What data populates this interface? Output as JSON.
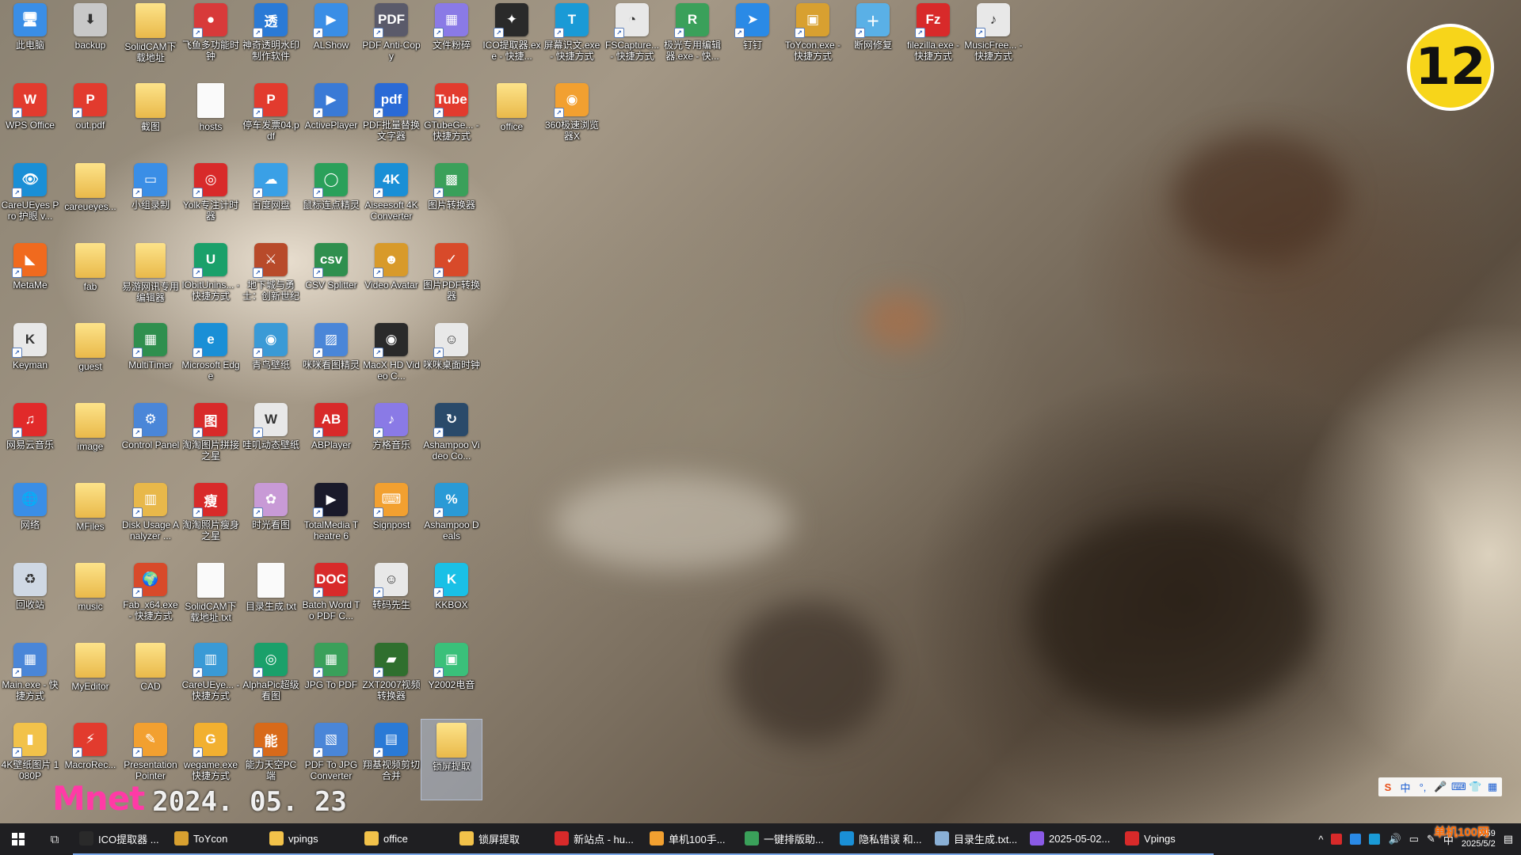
{
  "desktop": {
    "icons": [
      {
        "label": "此电脑",
        "color": "#3a8ee6",
        "glyph": "🖥",
        "kind": "app",
        "shortcut": false
      },
      {
        "label": "WPS Office",
        "color": "#e23b2e",
        "glyph": "W",
        "kind": "app",
        "shortcut": true
      },
      {
        "label": "CareUEyes Pro 护眼 v...",
        "color": "#1a8fd6",
        "glyph": "👁",
        "kind": "app",
        "shortcut": true
      },
      {
        "label": "MetaMe",
        "color": "#f06a1e",
        "glyph": "◣",
        "kind": "app",
        "shortcut": true
      },
      {
        "label": "Keyman",
        "color": "#e8e8e8",
        "glyph": "K",
        "kind": "app",
        "shortcut": true
      },
      {
        "label": "网易云音乐",
        "color": "#e12a2a",
        "glyph": "♫",
        "kind": "app",
        "shortcut": true
      },
      {
        "label": "网络",
        "color": "#3a8ee6",
        "glyph": "🌐",
        "kind": "app",
        "shortcut": false
      },
      {
        "label": "回收站",
        "color": "#cfd8e4",
        "glyph": "♻",
        "kind": "app",
        "shortcut": false
      },
      {
        "label": "Main.exe - 快捷方式",
        "color": "#4a86d8",
        "glyph": "▦",
        "kind": "app",
        "shortcut": true
      },
      {
        "label": "4K壁纸图片 1080P",
        "color": "#f2c24a",
        "glyph": "▮",
        "kind": "app",
        "shortcut": true
      },
      {
        "label": "backup",
        "color": "#c8c8c8",
        "glyph": "⬇",
        "kind": "app",
        "shortcut": false
      },
      {
        "label": "out.pdf",
        "color": "#e23b2e",
        "glyph": "P",
        "kind": "app",
        "shortcut": true
      },
      {
        "label": "careueyes...",
        "color": "",
        "glyph": "",
        "kind": "folder",
        "shortcut": false
      },
      {
        "label": "fab",
        "color": "",
        "glyph": "",
        "kind": "folder",
        "shortcut": false
      },
      {
        "label": "guest",
        "color": "",
        "glyph": "",
        "kind": "folder",
        "shortcut": false
      },
      {
        "label": "image",
        "color": "",
        "glyph": "",
        "kind": "folder",
        "shortcut": false
      },
      {
        "label": "MFiles",
        "color": "",
        "glyph": "",
        "kind": "folder",
        "shortcut": false
      },
      {
        "label": "music",
        "color": "",
        "glyph": "",
        "kind": "folder",
        "shortcut": false
      },
      {
        "label": "MyEditor",
        "color": "",
        "glyph": "",
        "kind": "folder",
        "shortcut": false
      },
      {
        "label": "MacroRec...",
        "color": "#e23b2e",
        "glyph": "⚡",
        "kind": "app",
        "shortcut": true
      },
      {
        "label": "SolidCAM下载地址",
        "color": "",
        "glyph": "",
        "kind": "folder",
        "shortcut": false
      },
      {
        "label": "截图",
        "color": "",
        "glyph": "",
        "kind": "folder",
        "shortcut": false
      },
      {
        "label": "小组录制",
        "color": "#3a8ee6",
        "glyph": "▭",
        "kind": "app",
        "shortcut": true
      },
      {
        "label": "易游网讯专用编辑器",
        "color": "",
        "glyph": "",
        "kind": "folder",
        "shortcut": false
      },
      {
        "label": "MultiTimer",
        "color": "#2f8f4e",
        "glyph": "▦",
        "kind": "app",
        "shortcut": true
      },
      {
        "label": "Control Panel",
        "color": "#4a86d8",
        "glyph": "⚙",
        "kind": "app",
        "shortcut": true
      },
      {
        "label": "Disk Usage Analyzer ...",
        "color": "#e8b84a",
        "glyph": "▥",
        "kind": "app",
        "shortcut": true
      },
      {
        "label": "Fab_x64.exe - 快捷方式",
        "color": "#d84a2a",
        "glyph": "🌍",
        "kind": "app",
        "shortcut": true
      },
      {
        "label": "CAD",
        "color": "",
        "glyph": "",
        "kind": "folder",
        "shortcut": false
      },
      {
        "label": "Presentation Pointer",
        "color": "#f2a030",
        "glyph": "✎",
        "kind": "app",
        "shortcut": true
      },
      {
        "label": "飞鱼多功能时钟",
        "color": "#d83a3a",
        "glyph": "●",
        "kind": "app",
        "shortcut": true
      },
      {
        "label": "hosts",
        "color": "",
        "glyph": "",
        "kind": "doc",
        "shortcut": false
      },
      {
        "label": "Yolk专注计时器",
        "color": "#d82a2a",
        "glyph": "◎",
        "kind": "app",
        "shortcut": true
      },
      {
        "label": "IObitUnins... - 快捷方式",
        "color": "#1aa06a",
        "glyph": "U",
        "kind": "app",
        "shortcut": true
      },
      {
        "label": "Microsoft Edge",
        "color": "#1a8fd6",
        "glyph": "e",
        "kind": "app",
        "shortcut": true
      },
      {
        "label": "淘淘图片拼接之星",
        "color": "#d82a2a",
        "glyph": "图",
        "kind": "app",
        "shortcut": true
      },
      {
        "label": "淘淘照片瘦身之星",
        "color": "#d82a2a",
        "glyph": "瘦",
        "kind": "app",
        "shortcut": true
      },
      {
        "label": "SolidCAM下载地址.txt",
        "color": "",
        "glyph": "",
        "kind": "doc",
        "shortcut": false
      },
      {
        "label": "CareUEye... - 快捷方式",
        "color": "#3a9ad6",
        "glyph": "▥",
        "kind": "app",
        "shortcut": true
      },
      {
        "label": "wegame.exe 快捷方式",
        "color": "#f2b030",
        "glyph": "G",
        "kind": "app",
        "shortcut": true
      },
      {
        "label": "神奇透明水印制作软件",
        "color": "#2a7ad6",
        "glyph": "透",
        "kind": "app",
        "shortcut": true
      },
      {
        "label": "停车发票04.pdf",
        "color": "#e23b2e",
        "glyph": "P",
        "kind": "app",
        "shortcut": true
      },
      {
        "label": "百度网盘",
        "color": "#3aa0e6",
        "glyph": "☁",
        "kind": "app",
        "shortcut": true
      },
      {
        "label": "地下城与勇士：创新世纪",
        "color": "#b84a2a",
        "glyph": "⚔",
        "kind": "app",
        "shortcut": true
      },
      {
        "label": "青鸟壁纸",
        "color": "#3a9ad6",
        "glyph": "◉",
        "kind": "app",
        "shortcut": true
      },
      {
        "label": "哇叽动态壁纸",
        "color": "#e8e8e8",
        "glyph": "W",
        "kind": "app",
        "shortcut": true
      },
      {
        "label": "时光看图",
        "color": "#c89ad6",
        "glyph": "✿",
        "kind": "app",
        "shortcut": true
      },
      {
        "label": "目录生成.txt",
        "color": "",
        "glyph": "",
        "kind": "doc",
        "shortcut": false
      },
      {
        "label": "AlphaPic超级看图",
        "color": "#1aa06a",
        "glyph": "◎",
        "kind": "app",
        "shortcut": true
      },
      {
        "label": "能力天空PC端",
        "color": "#d86a1a",
        "glyph": "能",
        "kind": "app",
        "shortcut": true
      },
      {
        "label": "ALShow",
        "color": "#3a8ee6",
        "glyph": "▶",
        "kind": "app",
        "shortcut": true
      },
      {
        "label": "ActivePlayer",
        "color": "#3a7ad6",
        "glyph": "▶",
        "kind": "app",
        "shortcut": true
      },
      {
        "label": "鼠标连点精灵",
        "color": "#2aa05a",
        "glyph": "◯",
        "kind": "app",
        "shortcut": true
      },
      {
        "label": "CSV Splitter",
        "color": "#2f8f4e",
        "glyph": "csv",
        "kind": "app",
        "shortcut": true
      },
      {
        "label": "咪咪看图精灵",
        "color": "#4a86d8",
        "glyph": "▨",
        "kind": "app",
        "shortcut": true
      },
      {
        "label": "ABPlayer",
        "color": "#d82a2a",
        "glyph": "AB",
        "kind": "app",
        "shortcut": true
      },
      {
        "label": "TotalMedia Theatre 6",
        "color": "#1a1a2a",
        "glyph": "▶",
        "kind": "app",
        "shortcut": true
      },
      {
        "label": "Batch Word To PDF C...",
        "color": "#d82a2a",
        "glyph": "DOC",
        "kind": "app",
        "shortcut": true
      },
      {
        "label": "JPG To PDF",
        "color": "#3aa05a",
        "glyph": "▦",
        "kind": "app",
        "shortcut": true
      },
      {
        "label": "PDF To JPG Converter",
        "color": "#4a86d8",
        "glyph": "▧",
        "kind": "app",
        "shortcut": true
      },
      {
        "label": "PDF Anti-Copy",
        "color": "#5a5a6a",
        "glyph": "PDF",
        "kind": "app",
        "shortcut": true
      },
      {
        "label": "PDF批量替换文字器",
        "color": "#2a6ad6",
        "glyph": "pdf",
        "kind": "app",
        "shortcut": true
      },
      {
        "label": "Aiseesoft 4K Converter",
        "color": "#1a8fd6",
        "glyph": "4K",
        "kind": "app",
        "shortcut": true
      },
      {
        "label": "Video Avatar",
        "color": "#d89a2a",
        "glyph": "☻",
        "kind": "app",
        "shortcut": true
      },
      {
        "label": "MacX HD Video C...",
        "color": "#2a2a2a",
        "glyph": "◉",
        "kind": "app",
        "shortcut": true
      },
      {
        "label": "方格音乐",
        "color": "#8a7ae6",
        "glyph": "♪",
        "kind": "app",
        "shortcut": true
      },
      {
        "label": "Signpost",
        "color": "#f2a030",
        "glyph": "⌨",
        "kind": "app",
        "shortcut": true
      },
      {
        "label": "转码先生",
        "color": "#e8e8e8",
        "glyph": "☺",
        "kind": "app",
        "shortcut": true
      },
      {
        "label": "ZXT2007视频转换器",
        "color": "#2f6f2e",
        "glyph": "▰",
        "kind": "app",
        "shortcut": true
      },
      {
        "label": "翔基视频剪切合并",
        "color": "#2a7ad6",
        "glyph": "▤",
        "kind": "app",
        "shortcut": true
      },
      {
        "label": "文件粉碎",
        "color": "#8a7ae6",
        "glyph": "▦",
        "kind": "app",
        "shortcut": true
      },
      {
        "label": "GTubeGe... - 快捷方式",
        "color": "#e23b2e",
        "glyph": "Tube",
        "kind": "app",
        "shortcut": true
      },
      {
        "label": "图片转换器",
        "color": "#3aa05a",
        "glyph": "▩",
        "kind": "app",
        "shortcut": true
      },
      {
        "label": "图片PDF转换器",
        "color": "#d84a2a",
        "glyph": "✓",
        "kind": "app",
        "shortcut": true
      },
      {
        "label": "咪咪桌面时钟",
        "color": "#e8e8e8",
        "glyph": "☺",
        "kind": "app",
        "shortcut": true
      },
      {
        "label": "Ashampoo Video Co...",
        "color": "#2a4a6a",
        "glyph": "↻",
        "kind": "app",
        "shortcut": true
      },
      {
        "label": "Ashampoo Deals",
        "color": "#2a9ad6",
        "glyph": "%",
        "kind": "app",
        "shortcut": true
      },
      {
        "label": "KKBOX",
        "color": "#1ac0e6",
        "glyph": "K",
        "kind": "app",
        "shortcut": true
      },
      {
        "label": "Y2002电音",
        "color": "#3ac07a",
        "glyph": "▣",
        "kind": "app",
        "shortcut": true
      },
      {
        "label": "锁屏提取",
        "color": "",
        "glyph": "",
        "kind": "folder",
        "shortcut": false,
        "selected": true
      },
      {
        "label": "ICO提取器.exe - 快捷...",
        "color": "#2a2a2a",
        "glyph": "✦",
        "kind": "app",
        "shortcut": true
      },
      {
        "label": "office",
        "color": "",
        "glyph": "",
        "kind": "folder",
        "shortcut": false
      },
      {
        "label": "",
        "color": "",
        "glyph": "",
        "kind": "empty",
        "shortcut": false
      },
      {
        "label": "",
        "color": "",
        "glyph": "",
        "kind": "empty",
        "shortcut": false
      },
      {
        "label": "",
        "color": "",
        "glyph": "",
        "kind": "empty",
        "shortcut": false
      },
      {
        "label": "",
        "color": "",
        "glyph": "",
        "kind": "empty",
        "shortcut": false
      },
      {
        "label": "",
        "color": "",
        "glyph": "",
        "kind": "empty",
        "shortcut": false
      },
      {
        "label": "",
        "color": "",
        "glyph": "",
        "kind": "empty",
        "shortcut": false
      },
      {
        "label": "",
        "color": "",
        "glyph": "",
        "kind": "empty",
        "shortcut": false
      },
      {
        "label": "",
        "color": "",
        "glyph": "",
        "kind": "empty",
        "shortcut": false
      },
      {
        "label": "屏幕识文.exe - 快捷方式",
        "color": "#1a9ad6",
        "glyph": "T",
        "kind": "app",
        "shortcut": true
      },
      {
        "label": "360极速浏览器X",
        "color": "#f2a030",
        "glyph": "◉",
        "kind": "app",
        "shortcut": true
      },
      {
        "label": "",
        "color": "",
        "glyph": "",
        "kind": "empty",
        "shortcut": false
      },
      {
        "label": "",
        "color": "",
        "glyph": "",
        "kind": "empty",
        "shortcut": false
      },
      {
        "label": "",
        "color": "",
        "glyph": "",
        "kind": "empty",
        "shortcut": false
      },
      {
        "label": "",
        "color": "",
        "glyph": "",
        "kind": "empty",
        "shortcut": false
      },
      {
        "label": "",
        "color": "",
        "glyph": "",
        "kind": "empty",
        "shortcut": false
      },
      {
        "label": "",
        "color": "",
        "glyph": "",
        "kind": "empty",
        "shortcut": false
      },
      {
        "label": "",
        "color": "",
        "glyph": "",
        "kind": "empty",
        "shortcut": false
      },
      {
        "label": "",
        "color": "",
        "glyph": "",
        "kind": "empty",
        "shortcut": false
      }
    ],
    "icons_row2": [
      {
        "label": "FSCapture... - 快捷方式",
        "color": "#e8e8e8",
        "glyph": "◔"
      },
      {
        "label": "极光专用编辑器.exe - 快...",
        "color": "#3aa05a",
        "glyph": "R"
      },
      {
        "label": "钉钉",
        "color": "#2a8ae6",
        "glyph": "➤"
      },
      {
        "label": "ToYcon.exe - 快捷方式",
        "color": "#d8a030",
        "glyph": "▣"
      },
      {
        "label": "断网修复",
        "color": "#5ab0e6",
        "glyph": "＋"
      },
      {
        "label": "filezilla.exe - 快捷方式",
        "color": "#d82a2a",
        "glyph": "Fz"
      },
      {
        "label": "MusicFree... - 快捷方式",
        "color": "#e8e8e8",
        "glyph": "♪"
      }
    ]
  },
  "badge": {
    "number": "12"
  },
  "watermark": {
    "logo": "Mnet",
    "date": "2024. 05. 23"
  },
  "ime": {
    "items": [
      "S",
      "中",
      "°,",
      "🎤",
      "⌨",
      "👕",
      "▦"
    ]
  },
  "taskbar": {
    "items": [
      {
        "label": "ICO提取器 ...",
        "color": "#2a2a2a"
      },
      {
        "label": "ToYcon",
        "color": "#d8a030"
      },
      {
        "label": "vpings",
        "color": "#f2c24a"
      },
      {
        "label": "office",
        "color": "#f2c24a"
      },
      {
        "label": "锁屏提取",
        "color": "#f2c24a"
      },
      {
        "label": "新站点 - hu...",
        "color": "#d82a2a"
      },
      {
        "label": "单机100手...",
        "color": "#f2a030"
      },
      {
        "label": "一键排版助...",
        "color": "#3aa05a"
      },
      {
        "label": "隐私错误 和...",
        "color": "#1a8fd6"
      },
      {
        "label": "目录生成.txt...",
        "color": "#8ab0d6"
      },
      {
        "label": "2025-05-02...",
        "color": "#8a5ae6"
      },
      {
        "label": "Vpings",
        "color": "#d82a2a"
      }
    ],
    "tray": {
      "lang": "中",
      "time": "5:59",
      "date": "2025/5/2"
    }
  },
  "site_watermark": "单机100网"
}
